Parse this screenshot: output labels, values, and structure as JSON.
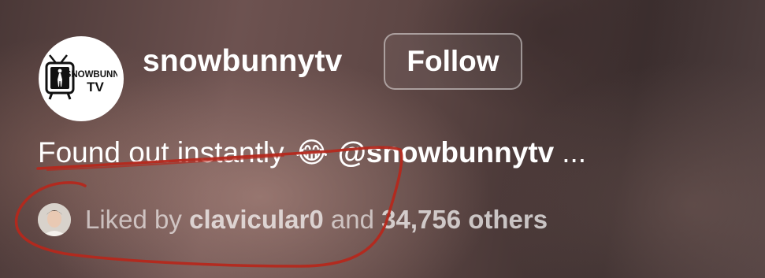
{
  "post": {
    "username": "snowbunnytv",
    "follow_label": "Follow",
    "logo_text_line1": "SNOWBUNNY",
    "logo_text_line2": "TV",
    "caption": {
      "text": "Found out instantly",
      "emoji": "😂",
      "mention": "@snowbunnytv",
      "more": "..."
    },
    "likes": {
      "prefix": "Liked by",
      "liker": "clavicular0",
      "conjunction": "and",
      "count": "34,756 others"
    }
  },
  "colors": {
    "text": "#ffffff",
    "annotation": "#b5281c"
  },
  "icons": [
    "snowbunnytv-logo",
    "liker-avatar"
  ]
}
